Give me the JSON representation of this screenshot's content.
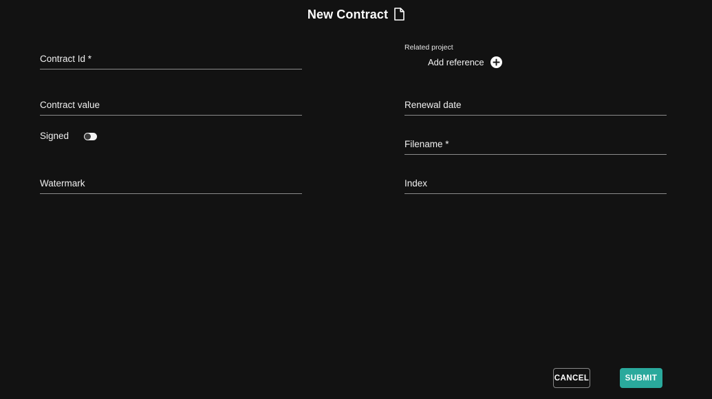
{
  "header": {
    "title": "New Contract",
    "icon": "document-icon"
  },
  "colors": {
    "background": "#121212",
    "accent": "#2aa99c",
    "underline": "#8c8c8c",
    "text": "#ffffff"
  },
  "form": {
    "left_column": [
      {
        "key": "contract_id",
        "label": "Contract Id *",
        "value": "",
        "placeholder": ""
      },
      {
        "key": "contract_value",
        "label": "Contract value",
        "value": "",
        "placeholder": ""
      },
      {
        "key": "watermark",
        "label": "Watermark",
        "value": "",
        "placeholder": ""
      }
    ],
    "right_column": [
      {
        "key": "renewal_date",
        "label": "Renewal date",
        "value": "",
        "placeholder": ""
      },
      {
        "key": "filename",
        "label": "Filename *",
        "value": "",
        "placeholder": ""
      },
      {
        "key": "index",
        "label": "Index",
        "value": "",
        "placeholder": ""
      }
    ],
    "toggle": {
      "key": "signed",
      "label": "Signed",
      "state": "off"
    },
    "related_project": {
      "caption": "Related project",
      "add_label": "Add reference",
      "add_icon": "plus-circle-icon"
    }
  },
  "footer": {
    "cancel_label": "CANCEL",
    "submit_label": "SUBMIT"
  }
}
